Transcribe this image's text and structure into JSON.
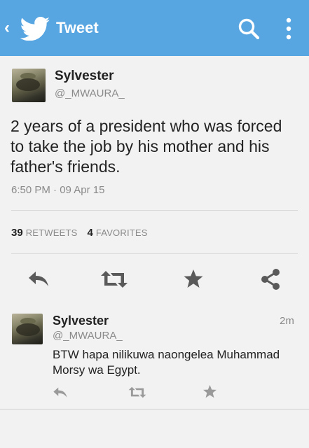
{
  "appbar": {
    "back_glyph": "‹",
    "title": "Tweet",
    "icons": [
      "back-icon",
      "twitter-bird-icon",
      "search-icon",
      "more-vert-icon"
    ],
    "color": "#58a6e1"
  },
  "tweet": {
    "name": "Sylvester",
    "handle": "@_MWAURA_",
    "text": "2 years of a president who was forced to take the job by his mother and his father's friends.",
    "time": "6:50 PM · 09 Apr 15",
    "retweets": "39",
    "retweets_label": "RETWEETS",
    "favorites": "4",
    "favorites_label": "FAVORITES",
    "actions": [
      "reply-icon",
      "retweet-icon",
      "favorite-icon",
      "share-icon"
    ]
  },
  "reply": {
    "name": "Sylvester",
    "handle": "@_MWAURA_",
    "age": "2m",
    "text": "BTW hapa nilikuwa naongelea Muhammad Morsy wa Egypt.",
    "actions": [
      "reply-icon",
      "retweet-icon",
      "favorite-icon"
    ]
  },
  "colors": {
    "text": "#222222",
    "muted": "#8a8a8a",
    "icon": "#5a5a5a",
    "icon_faint": "#9a9a9a"
  }
}
